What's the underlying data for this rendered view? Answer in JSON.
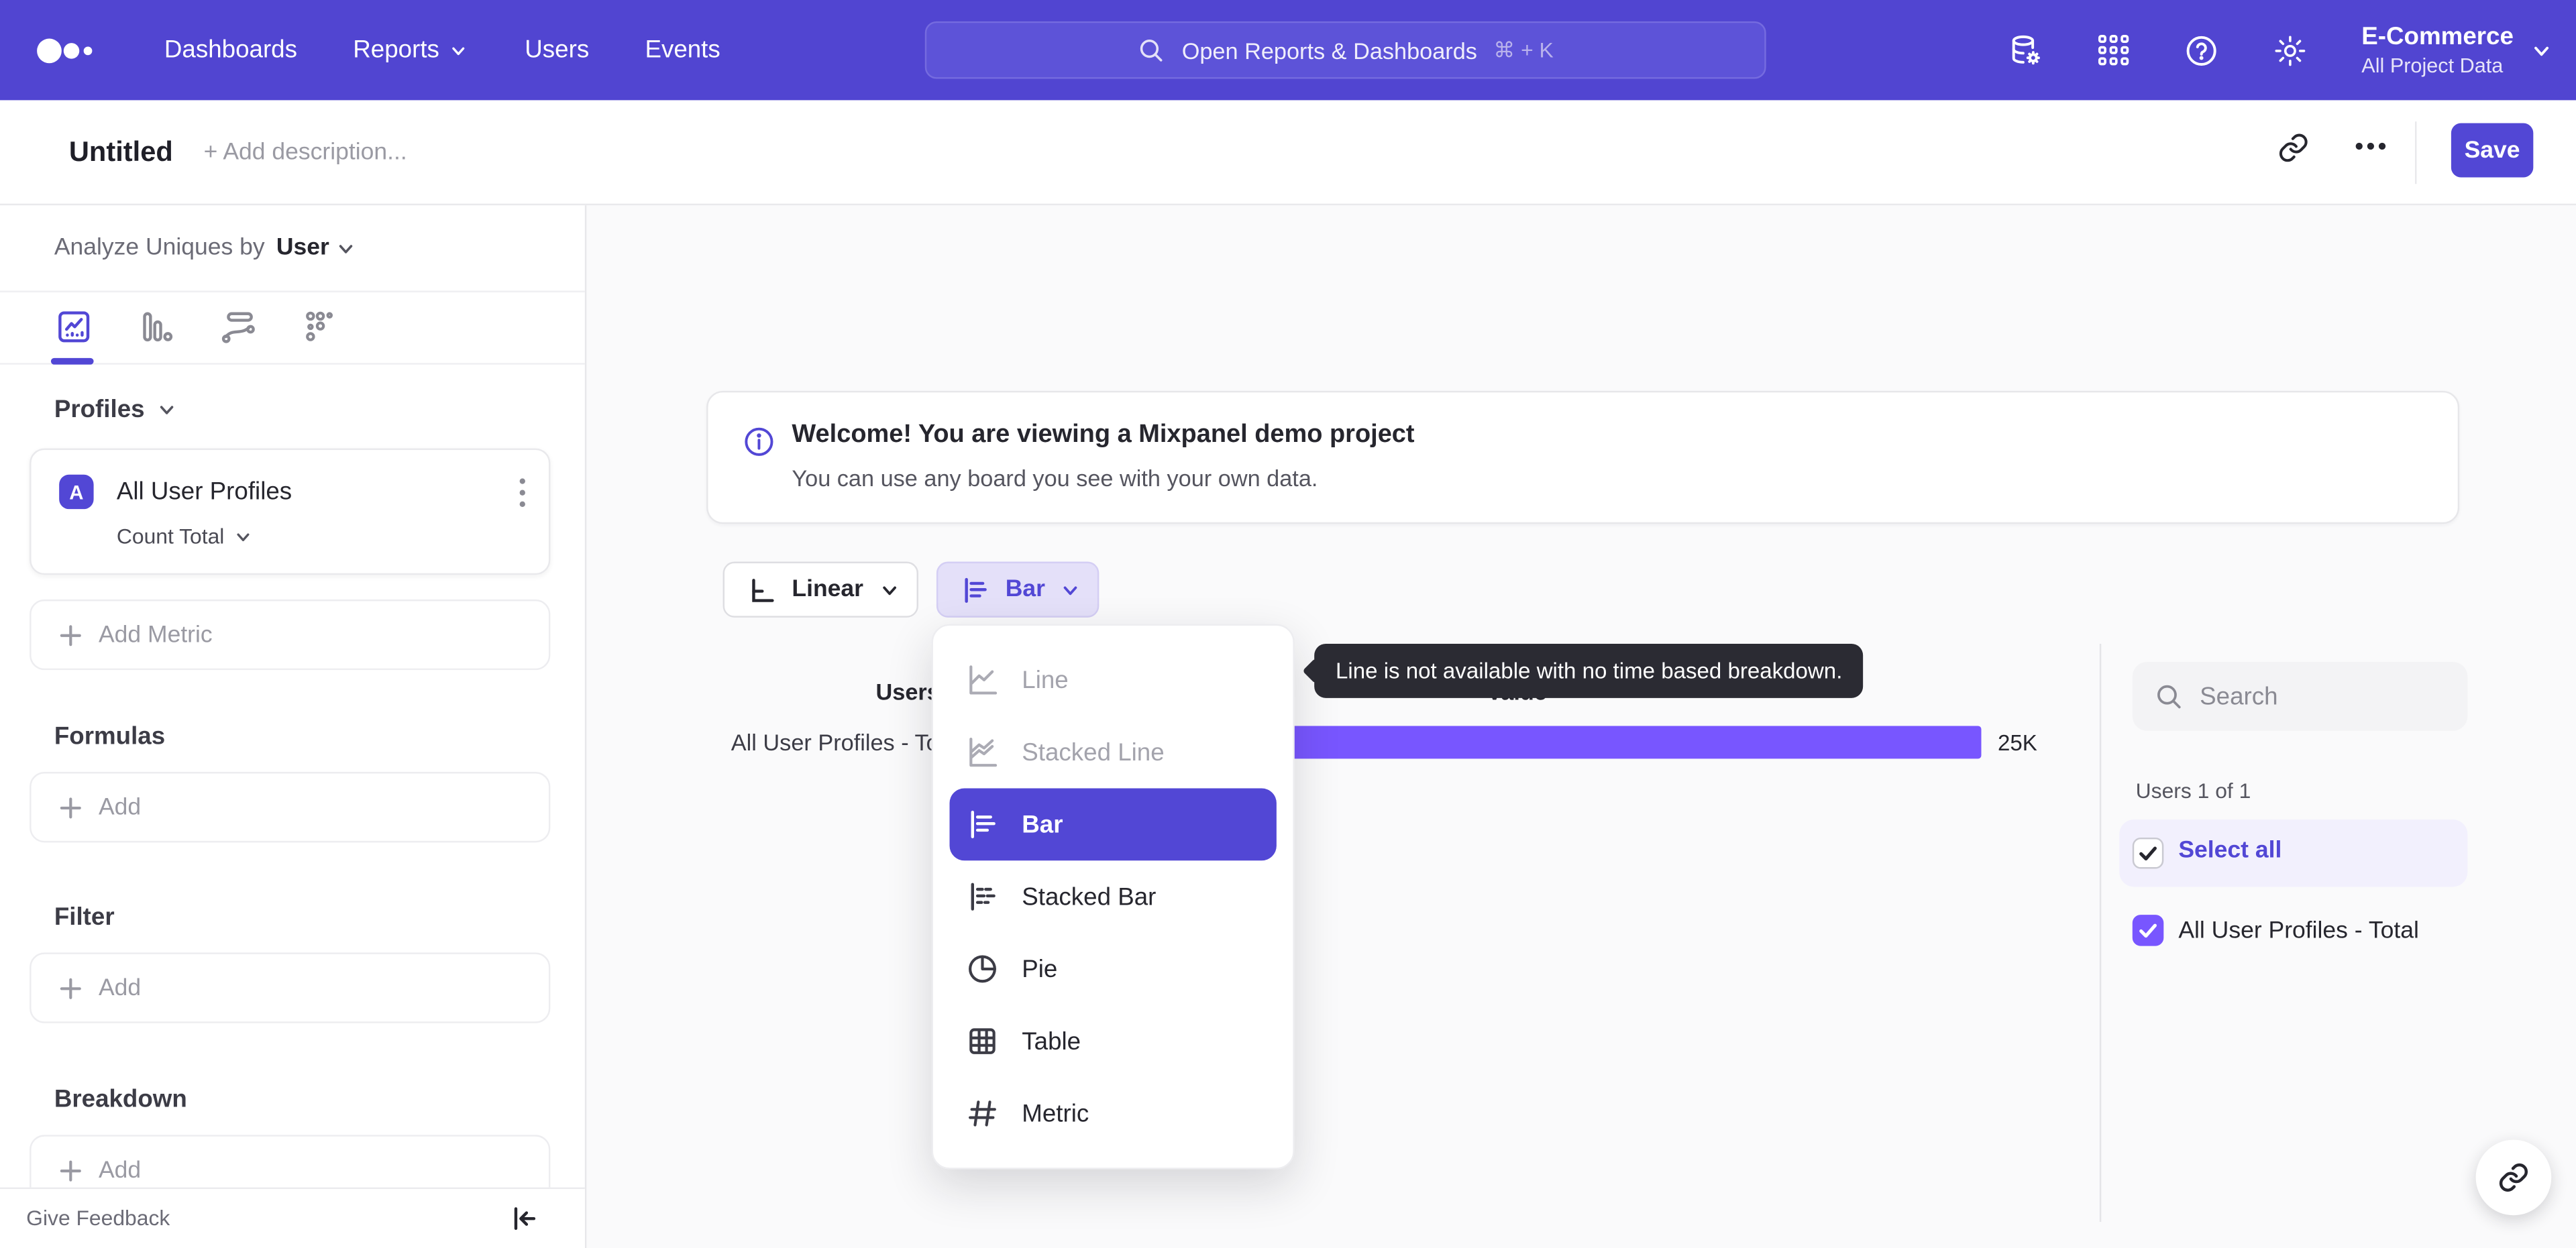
{
  "nav": {
    "items": [
      {
        "label": "Dashboards"
      },
      {
        "label": "Reports"
      },
      {
        "label": "Users"
      },
      {
        "label": "Events"
      }
    ],
    "search": {
      "placeholder": "Open Reports & Dashboards",
      "shortcut": "⌘ + K"
    },
    "project": {
      "name": "E-Commerce",
      "scope": "All Project Data"
    }
  },
  "header": {
    "title": "Untitled",
    "description_placeholder": "+ Add description...",
    "save_label": "Save"
  },
  "sidebar": {
    "analyze": {
      "prefix": "Analyze Uniques by",
      "value": "User"
    },
    "profiles": {
      "title": "Profiles",
      "metric": {
        "badge": "A",
        "name": "All User Profiles",
        "aggregation": "Count Total"
      },
      "add_label": "Add Metric"
    },
    "formulas": {
      "title": "Formulas",
      "add_label": "Add"
    },
    "filter": {
      "title": "Filter",
      "add_label": "Add"
    },
    "breakdown": {
      "title": "Breakdown",
      "add_label": "Add"
    },
    "footer": {
      "feedback_label": "Give Feedback"
    }
  },
  "banner": {
    "title": "Welcome! You are viewing a Mixpanel demo project",
    "subtitle": "You can use any board you see with your own data."
  },
  "controls": {
    "scale_label": "Linear",
    "chart_type_label": "Bar"
  },
  "dropdown": {
    "items": [
      {
        "label": "Line",
        "state": "disabled"
      },
      {
        "label": "Stacked Line",
        "state": "disabled"
      },
      {
        "label": "Bar",
        "state": "selected"
      },
      {
        "label": "Stacked Bar",
        "state": "normal"
      },
      {
        "label": "Pie",
        "state": "normal"
      },
      {
        "label": "Table",
        "state": "normal"
      },
      {
        "label": "Metric",
        "state": "normal"
      }
    ]
  },
  "tooltip": {
    "text": "Line is not available with no time based breakdown."
  },
  "chart_data": {
    "type": "bar",
    "orientation": "horizontal",
    "columns": [
      "Users",
      "Value"
    ],
    "categories": [
      "All User Profiles - Total"
    ],
    "values": [
      25000
    ],
    "value_labels": [
      "25K"
    ],
    "series_color": "#7856FF",
    "xlim": [
      0,
      25000
    ],
    "grid": false,
    "legend_position": "right"
  },
  "legend": {
    "search_placeholder": "Search",
    "count_label": "Users 1 of 1",
    "select_all_label": "Select all",
    "items": [
      {
        "label": "All User Profiles - Total",
        "checked": true
      }
    ]
  },
  "colors": {
    "nav_bg": "#5145D1",
    "accent": "#5247D5",
    "bar": "#7856FF",
    "chip_bg": "#E4E0F9",
    "row_highlight": "#F2F0FD",
    "tooltip_bg": "#2B2B33"
  }
}
